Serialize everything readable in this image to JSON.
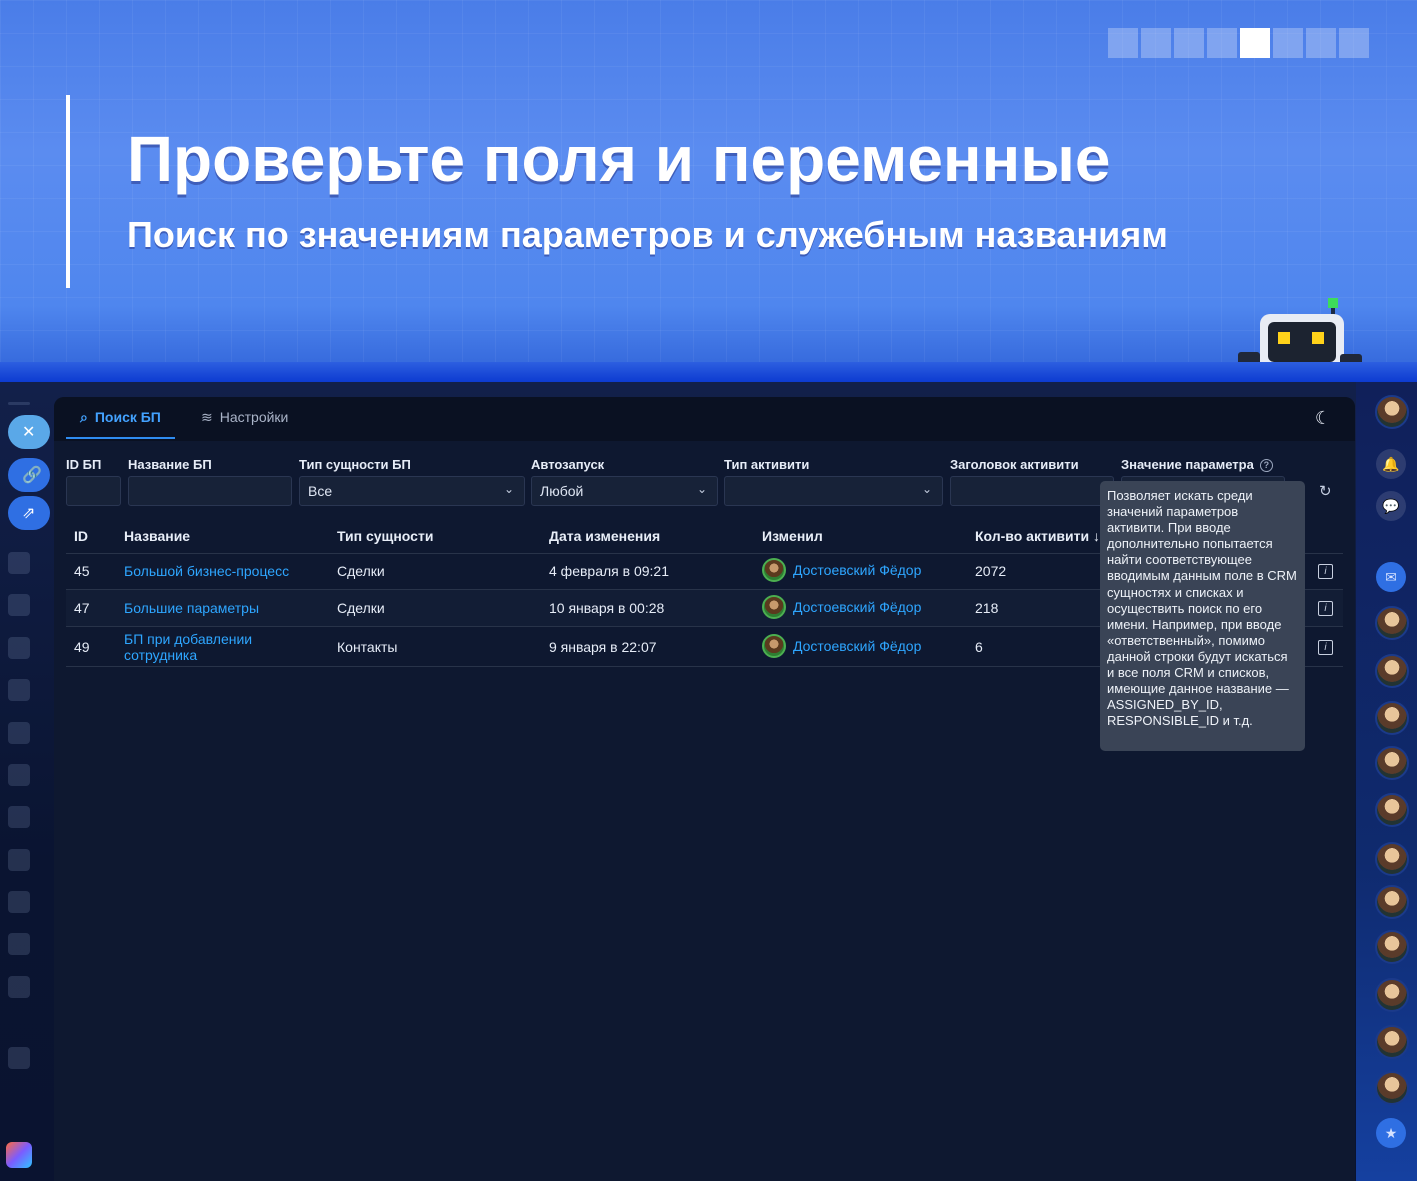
{
  "banner": {
    "headline": "Проверьте поля и переменные",
    "subline": "Поиск по значениям параметров и служебным названиям",
    "slides_total": 8,
    "active_slide": 5
  },
  "tabs": [
    {
      "label": "Поиск БП",
      "icon": "search-icon",
      "active": true
    },
    {
      "label": "Настройки",
      "icon": "sliders-icon",
      "active": false
    }
  ],
  "filters": {
    "id_label": "ID БП",
    "name_label": "Название БП",
    "entity_type_label": "Тип сущности БП",
    "entity_type_value": "Все",
    "autostart_label": "Автозапуск",
    "autostart_value": "Любой",
    "activity_type_label": "Тип активити",
    "activity_title_label": "Заголовок активити",
    "param_value_label": "Значение параметра"
  },
  "table": {
    "columns": [
      "ID",
      "Название",
      "Тип сущности",
      "Дата изменения",
      "Изменил",
      "Кол-во активити ↓"
    ],
    "rows": [
      {
        "id": "45",
        "name": "Большой бизнес-процесс",
        "entity": "Сделки",
        "date": "4 февраля в 09:21",
        "user": "Достоевский Фёдор",
        "count": "2072"
      },
      {
        "id": "47",
        "name": "Большие параметры",
        "entity": "Сделки",
        "date": "10 января в 00:28",
        "user": "Достоевский Фёдор",
        "count": "218"
      },
      {
        "id": "49",
        "name": "БП при добавлении сотрудника",
        "entity": "Контакты",
        "date": "9 января в 22:07",
        "user": "Достоевский Фёдор",
        "count": "6"
      }
    ]
  },
  "tooltip": {
    "text": "Позволяет искать среди значений параметров активити. При вводе дополнительно попытается найти соответствующее вводимым данным поле в CRM сущностях и списках и осуществить поиск по его имени. Например, при вводе «ответственный», помимо данной строки будут искаться и все поля CRM и списков, имеющие данное название — ASSIGNED_BY_ID, RESPONSIBLE_ID и т.д."
  },
  "colors": {
    "banner_blue": "#4f86ee",
    "accent_link": "#2ea6ff",
    "panel_bg": "#0e1830",
    "tooltip_bg": "#3a4456"
  }
}
